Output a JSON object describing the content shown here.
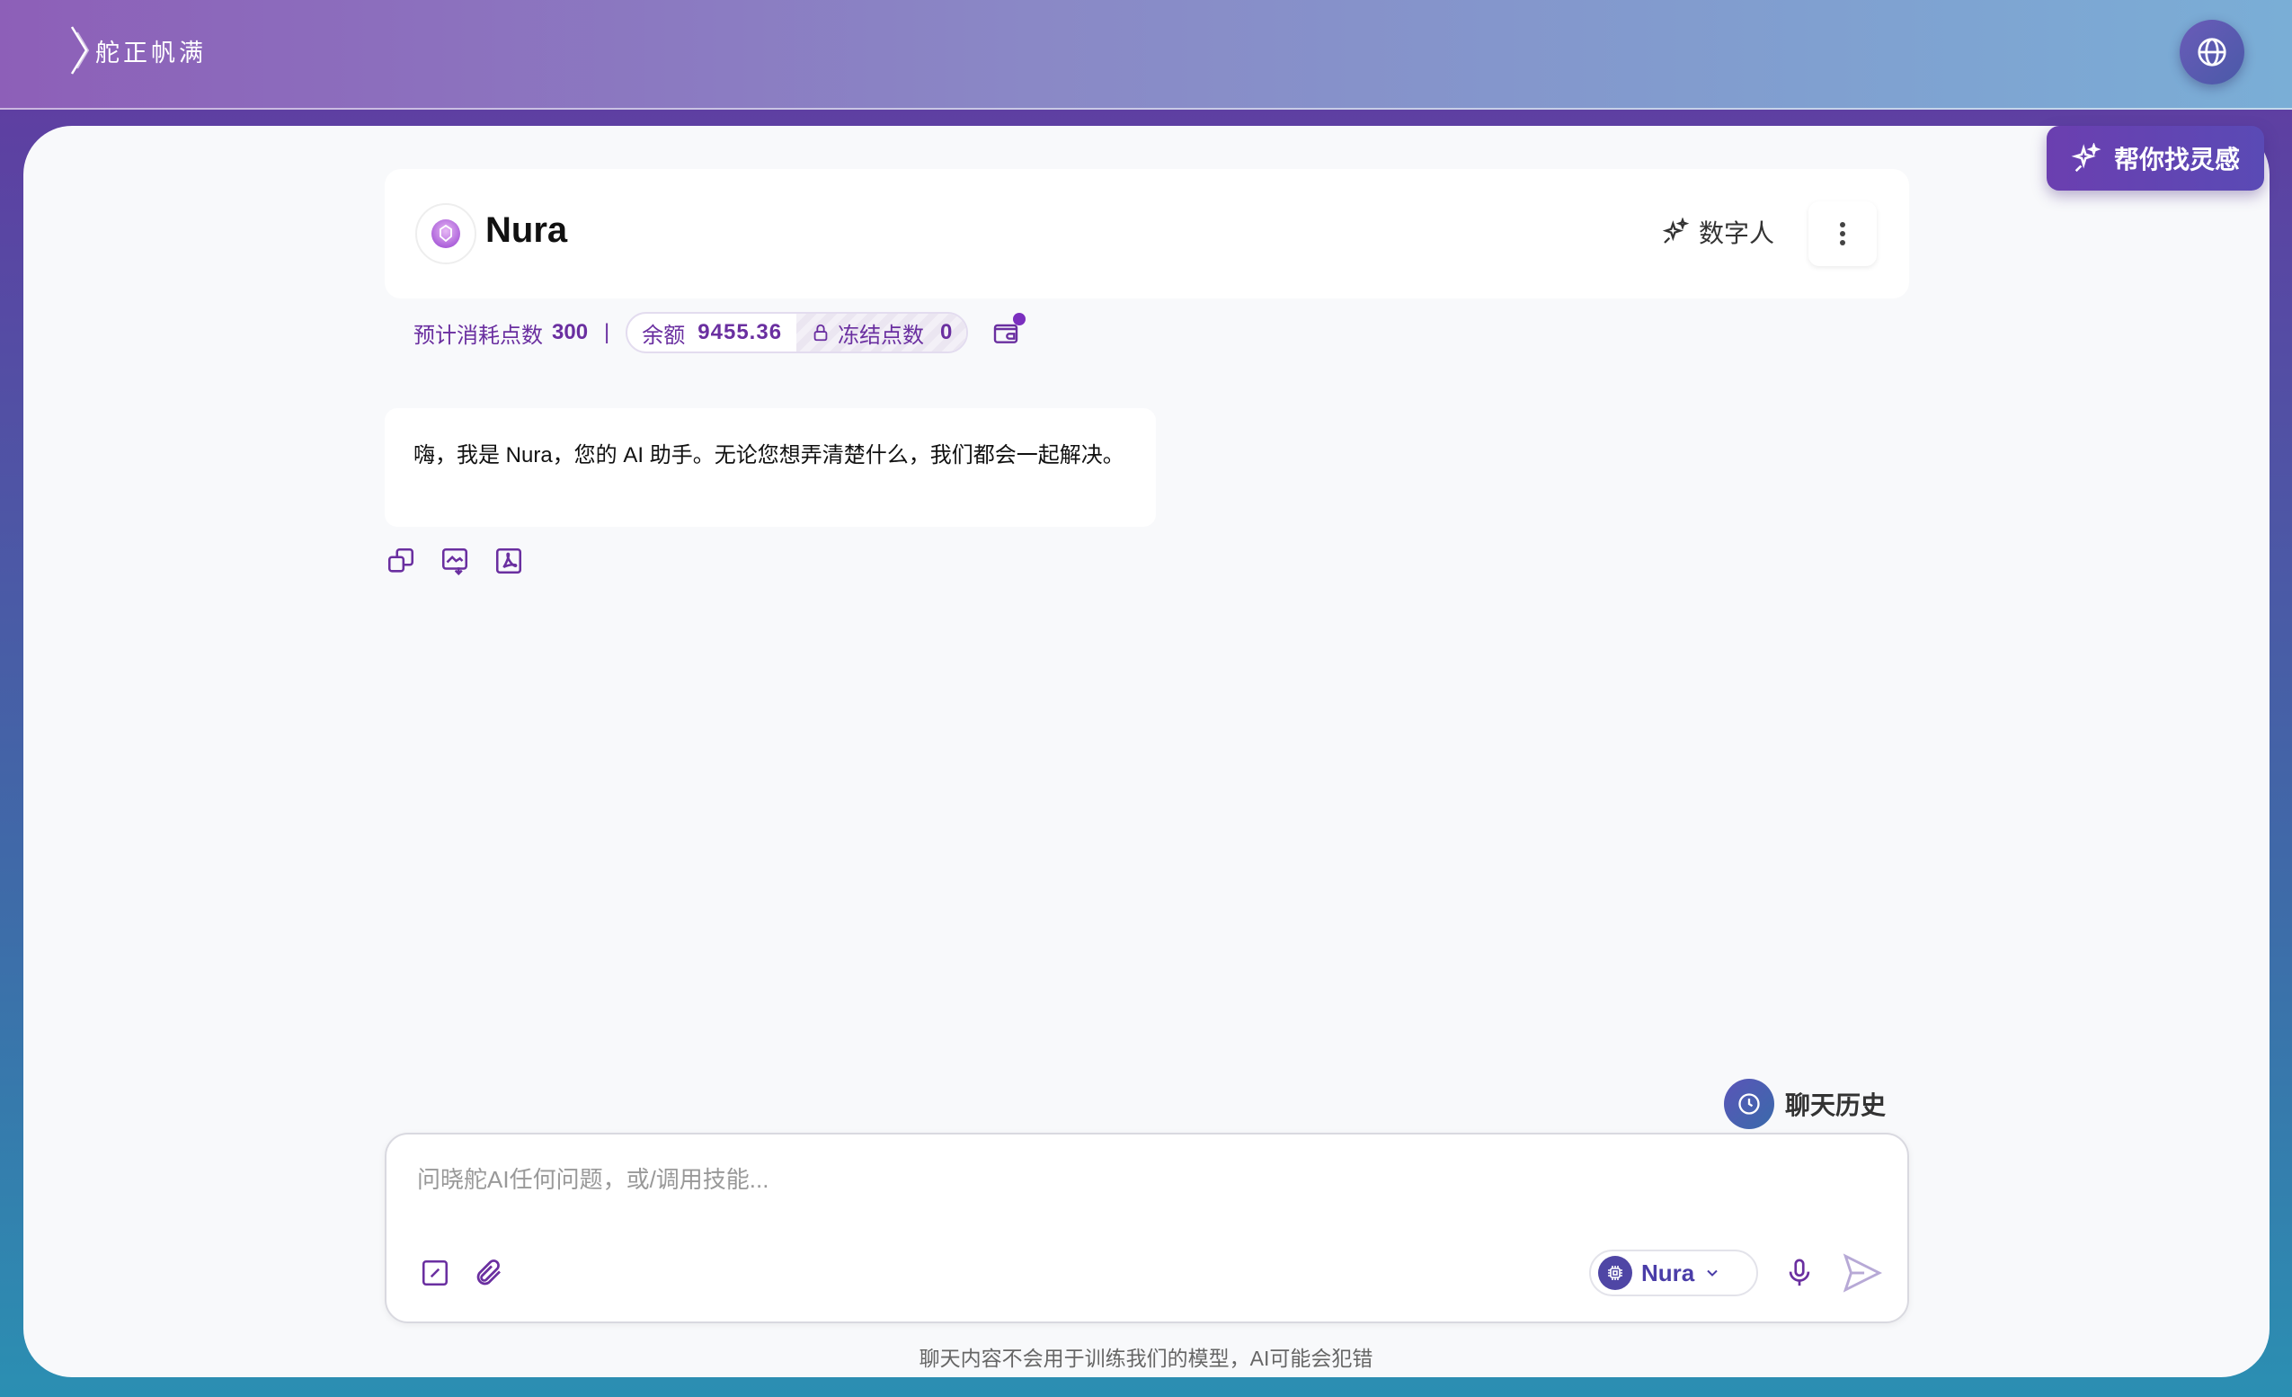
{
  "topbar": {
    "logo_text": "舵正帆满"
  },
  "inspire": {
    "label": "帮你找灵感"
  },
  "agent": {
    "name": "Nura",
    "digital_human_label": "数字人"
  },
  "stats": {
    "estimated_label": "预计消耗点数",
    "estimated_value": "300",
    "separator": "|",
    "balance_label": "余额",
    "balance_value": "9455.36",
    "frozen_label": "冻结点数",
    "frozen_value": "0"
  },
  "message": {
    "text": "嗨，我是 Nura，您的 AI 助手。无论您想弄清楚什么，我们都会一起解决。"
  },
  "history": {
    "label": "聊天历史"
  },
  "composer": {
    "placeholder": "问晓舵AI任何问题，或/调用技能...",
    "model_label": "Nura"
  },
  "disclaimer": "聊天内容不会用于训练我们的模型，AI可能会犯错",
  "colors": {
    "accent": "#6a2fa0",
    "brand_gradient_start": "#8d5fb8",
    "brand_gradient_end": "#7aaed6"
  }
}
